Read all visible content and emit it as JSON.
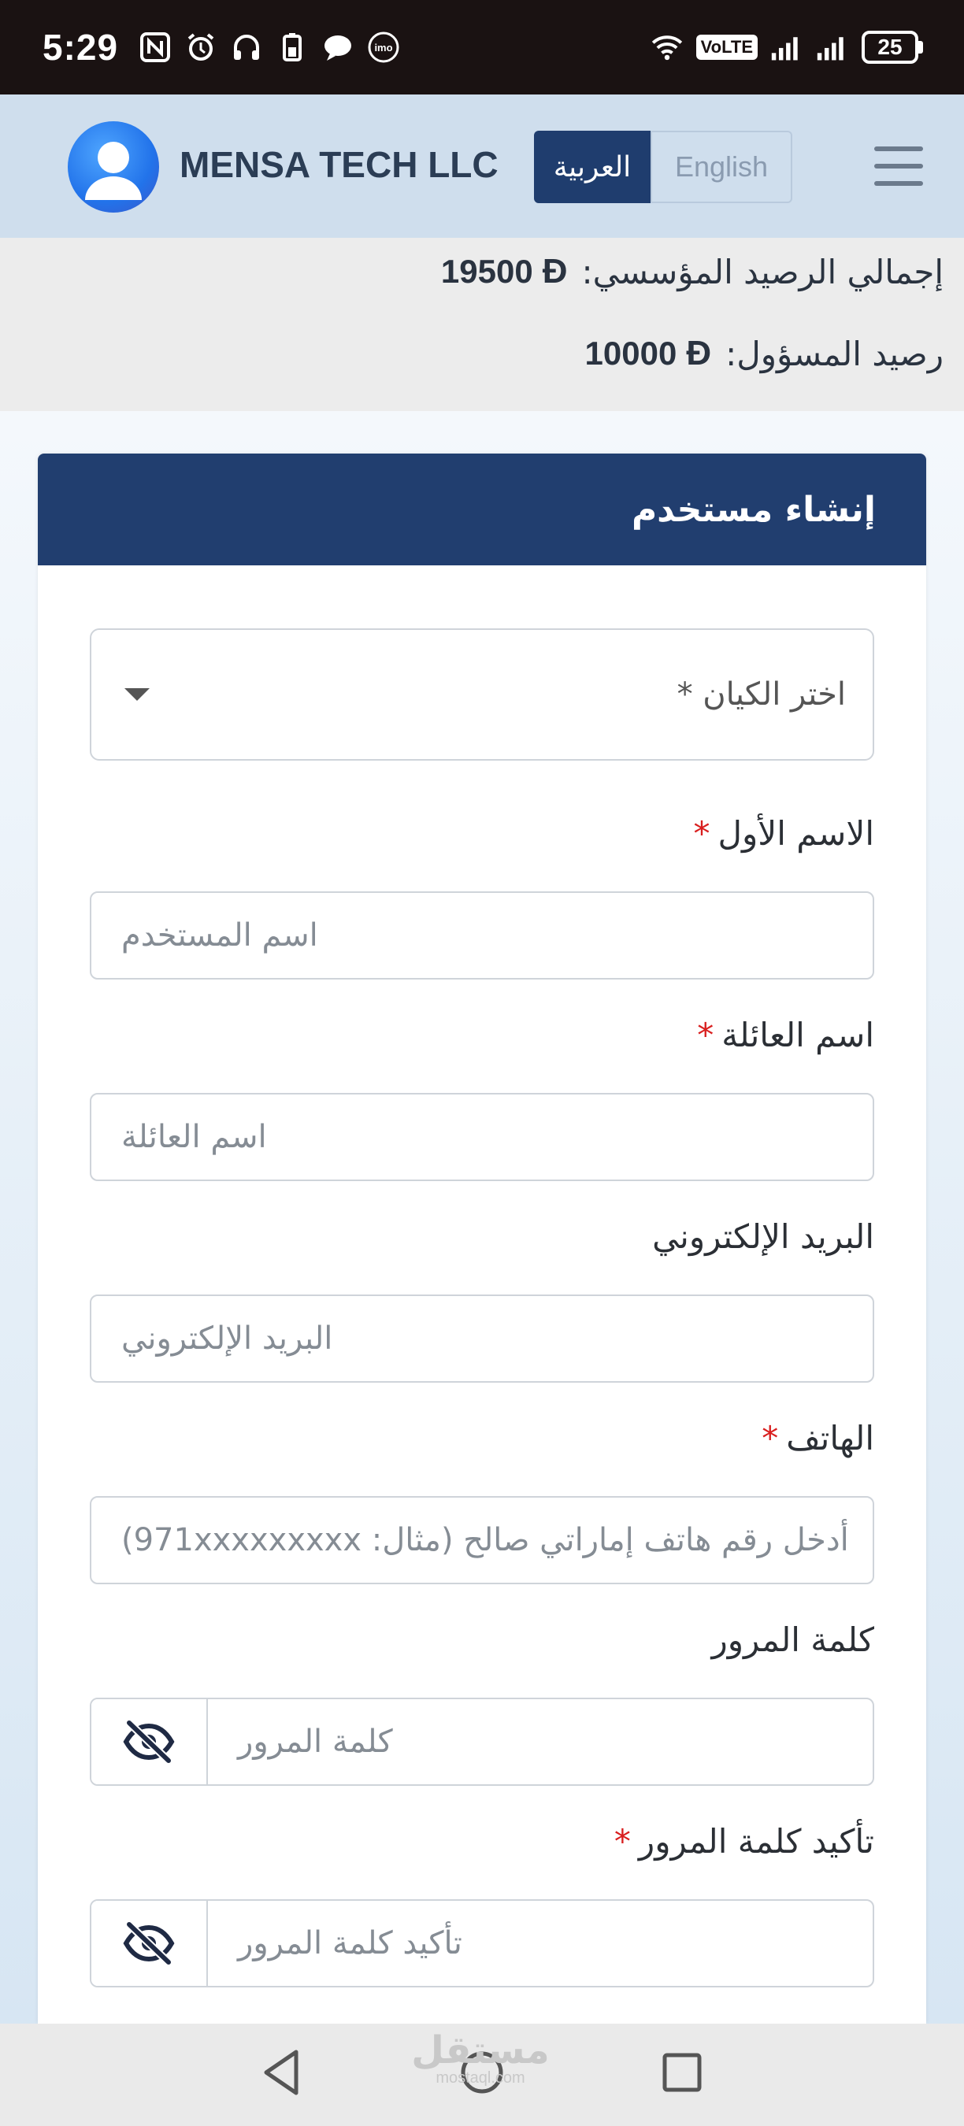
{
  "status_bar": {
    "time": "5:29",
    "volte": "VoLTE",
    "battery": "25"
  },
  "header": {
    "brand": "MENSA TECH LLC",
    "lang_arabic": "العربية",
    "lang_english": "English"
  },
  "balances": {
    "total_label": "إجمالي الرصيد المؤسسي:",
    "total_value": "19500",
    "admin_label": "رصيد المسؤول:",
    "admin_value": "10000",
    "currency_symbol": "Đ"
  },
  "form": {
    "title": "إنشاء مستخدم",
    "entity_select": "اختر الكيان *",
    "first_name_label": "الاسم الأول",
    "first_name_placeholder": "اسم المستخدم",
    "last_name_label": "اسم العائلة",
    "last_name_placeholder": "اسم العائلة",
    "email_label": "البريد الإلكتروني",
    "email_placeholder": "البريد الإلكتروني",
    "phone_label": "الهاتف",
    "phone_placeholder": "أدخل رقم هاتف إماراتي صالح (مثال: 971xxxxxxxxx)",
    "password_label": "كلمة المرور",
    "password_placeholder": "كلمة المرور",
    "confirm_label": "تأكيد كلمة المرور",
    "confirm_placeholder": "تأكيد كلمة المرور",
    "required_mark": "*"
  },
  "watermark": {
    "main": "مستقل",
    "sub": "mostaql.com"
  },
  "colors": {
    "primary": "#213e6f",
    "header_bg": "#cfdeed",
    "required": "#d91f1f"
  }
}
